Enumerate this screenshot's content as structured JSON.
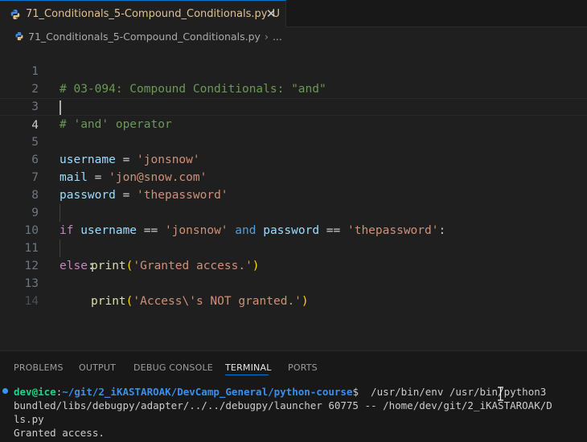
{
  "tab": {
    "filename": "71_Conditionals_5-Compound_Conditionals.py",
    "modified": "U",
    "close": "✕"
  },
  "breadcrumb": {
    "file": "71_Conditionals_5-Compound_Conditionals.py",
    "more": "..."
  },
  "editor": {
    "line_numbers": [
      "1",
      "2",
      "3",
      "4",
      "5",
      "6",
      "7",
      "8",
      "9",
      "10",
      "11",
      "12",
      "13",
      "14"
    ],
    "lines": {
      "l1": "# 03-094: Compound Conditionals: \"and\"",
      "l3": "# 'and' operator",
      "l5_var": "username",
      "l5_eq": " = ",
      "l5_str": "'jonsnow'",
      "l6_var": "mail",
      "l6_eq": " = ",
      "l6_str": "'jon@snow.com'",
      "l7_var": "password",
      "l7_eq": " = ",
      "l7_str": "'thepassword'",
      "l9_if": "if",
      "l9_sp1": " ",
      "l9_v1": "username",
      "l9_eq1": " == ",
      "l9_s1": "'jonsnow'",
      "l9_sp2": " ",
      "l9_and": "and",
      "l9_sp3": " ",
      "l9_v2": "password",
      "l9_eq2": " == ",
      "l9_s2": "'thepassword'",
      "l9_colon": ":",
      "l10_fn": "print",
      "l10_open": "(",
      "l10_str": "'Granted access.'",
      "l10_close": ")",
      "l11_else": "else",
      "l11_colon": ":",
      "l12_fn": "print",
      "l12_open": "(",
      "l12_str": "'Access\\'s NOT granted.'",
      "l12_close": ")"
    }
  },
  "panel": {
    "tabs": [
      "PROBLEMS",
      "OUTPUT",
      "DEBUG CONSOLE",
      "TERMINAL",
      "PORTS"
    ],
    "active_tab": "TERMINAL"
  },
  "terminal": {
    "user": "dev@ice",
    "sep": ":",
    "path": "~/git/2_iKASTAROAK/DevCamp_General/python-course",
    "prompt": "$ ",
    "command": " /usr/bin/env /usr/bin/python3",
    "line2": "bundled/libs/debugpy/adapter/../../debugpy/launcher 60775 -- /home/dev/git/2_iKASTAROAK/D",
    "line3": "ls.py",
    "line4": "Granted access."
  },
  "colors": {
    "accent": "#0078d4",
    "comment": "#6a9955",
    "string": "#ce9178",
    "keyword": "#c586c0",
    "variable": "#9cdcfe",
    "function": "#dcdcaa"
  },
  "icons": {
    "python": "python-file-icon",
    "close": "close-icon"
  }
}
